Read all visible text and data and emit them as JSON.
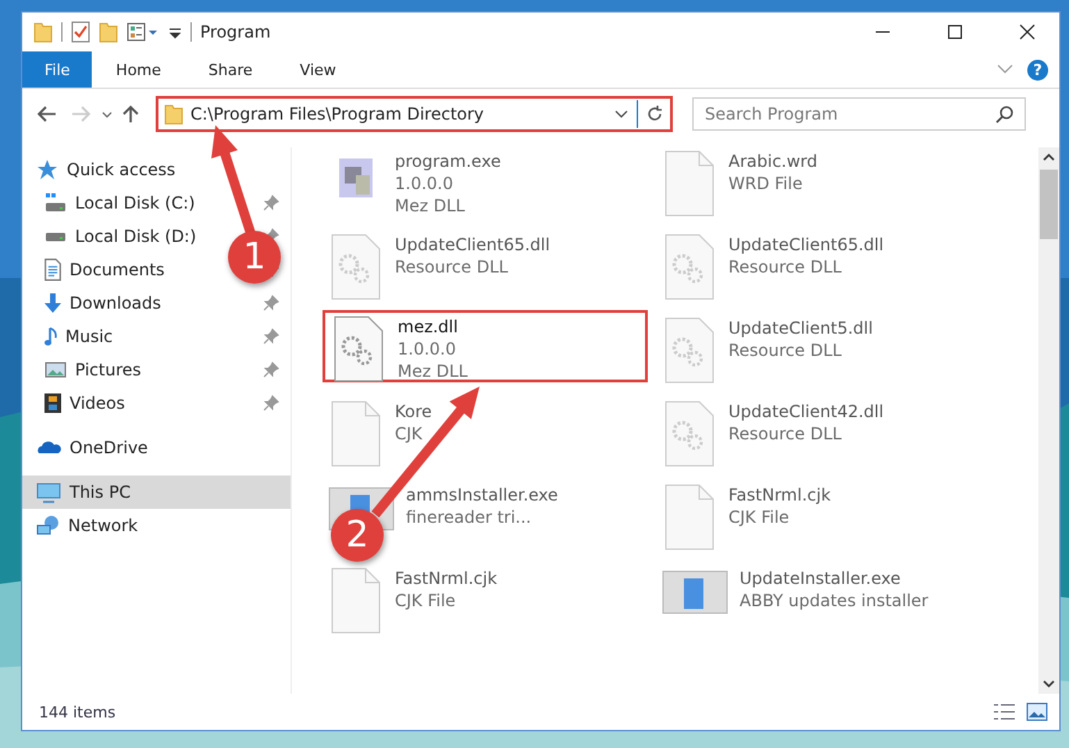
{
  "window": {
    "title": "Program"
  },
  "ribbon": {
    "tabs": [
      {
        "label": "File",
        "selected": true
      },
      {
        "label": "Home",
        "selected": false
      },
      {
        "label": "Share",
        "selected": false
      },
      {
        "label": "View",
        "selected": false
      }
    ],
    "help": "?"
  },
  "address": {
    "path": "C:\\Program Files\\Program Directory",
    "highlighted": true,
    "back_disabled": false,
    "forward_disabled": true
  },
  "search": {
    "placeholder": "Search Program"
  },
  "sidebar": {
    "items": [
      {
        "label": "Quick access",
        "kind": "quick",
        "pinned": false,
        "selected": false,
        "children": [
          {
            "label": "Local Disk (C:)",
            "kind": "disk-c",
            "pinned": true,
            "selected": false
          },
          {
            "label": "Local Disk (D:)",
            "kind": "disk",
            "pinned": true,
            "selected": false
          },
          {
            "label": "Documents",
            "kind": "documents",
            "pinned": true,
            "selected": false
          },
          {
            "label": "Downloads",
            "kind": "downloads",
            "pinned": true,
            "selected": false
          },
          {
            "label": "Music",
            "kind": "music",
            "pinned": true,
            "selected": false
          },
          {
            "label": "Pictures",
            "kind": "pictures",
            "pinned": true,
            "selected": false
          },
          {
            "label": "Videos",
            "kind": "videos",
            "pinned": true,
            "selected": false
          }
        ]
      },
      {
        "label": "OneDrive",
        "kind": "cloud",
        "pinned": false,
        "selected": false
      },
      {
        "label": "This PC",
        "kind": "pc",
        "pinned": false,
        "selected": true
      },
      {
        "label": "Network",
        "kind": "network",
        "pinned": false,
        "selected": false
      }
    ]
  },
  "files": [
    {
      "name": "program.exe",
      "lines": [
        "1.0.0.0",
        "Mez DLL"
      ],
      "kind": "exe",
      "highlighted": false
    },
    {
      "name": "Arabic.wrd",
      "lines": [
        "WRD File"
      ],
      "kind": "blank",
      "highlighted": false
    },
    {
      "name": "UpdateClient65.dll",
      "lines": [
        "Resource DLL"
      ],
      "kind": "dll",
      "highlighted": false
    },
    {
      "name": "UpdateClient65.dll",
      "lines": [
        "Resource DLL"
      ],
      "kind": "dll",
      "highlighted": false
    },
    {
      "name": "mez.dll",
      "lines": [
        "1.0.0.0",
        "Mez DLL"
      ],
      "kind": "dll",
      "highlighted": true
    },
    {
      "name": "UpdateClient5.dll",
      "lines": [
        "Resource DLL"
      ],
      "kind": "dll",
      "highlighted": false
    },
    {
      "name": "Kore",
      "lines": [
        "CJK"
      ],
      "kind": "blank",
      "highlighted": false
    },
    {
      "name": "UpdateClient42.dll",
      "lines": [
        "Resource DLL"
      ],
      "kind": "dll",
      "highlighted": false
    },
    {
      "name": "ammsInstaller.exe",
      "lines": [
        "finereader tri..."
      ],
      "kind": "installer",
      "highlighted": false
    },
    {
      "name": "FastNrml.cjk",
      "lines": [
        "CJK File"
      ],
      "kind": "blank",
      "highlighted": false
    },
    {
      "name": "FastNrml.cjk",
      "lines": [
        "CJK File"
      ],
      "kind": "blank",
      "highlighted": false
    },
    {
      "name": "UpdateInstaller.exe",
      "lines": [
        "ABBY updates installer"
      ],
      "kind": "installer",
      "highlighted": false
    }
  ],
  "annotations": [
    {
      "label": "1"
    },
    {
      "label": "2"
    }
  ],
  "status_bar": {
    "count": "144 items"
  }
}
